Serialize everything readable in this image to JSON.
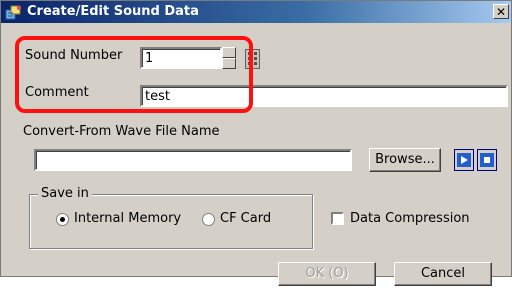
{
  "window": {
    "title": "Create/Edit Sound Data",
    "close_glyph": "✕"
  },
  "form": {
    "sound_number_label": "Sound Number",
    "sound_number_value": "1",
    "comment_label": "Comment",
    "comment_value": "test",
    "wave_file_label": "Convert-From Wave File Name",
    "wave_file_value": "",
    "browse_label": "Browse..."
  },
  "save_in": {
    "label": "Save in",
    "options": [
      {
        "label": "Internal Memory",
        "checked": true
      },
      {
        "label": "CF Card",
        "checked": false
      }
    ]
  },
  "compression": {
    "label": "Data Compression",
    "checked": false
  },
  "footer": {
    "ok_label": "OK (O)",
    "cancel_label": "Cancel"
  },
  "colors": {
    "title_start": "#0a246a",
    "highlight": "#ff1010",
    "play_blue": "#1f5fd0"
  },
  "icons": [
    "app-icon",
    "close-icon",
    "spin-up-icon",
    "spin-down-icon",
    "keypad-icon",
    "play-icon",
    "stop-icon"
  ]
}
